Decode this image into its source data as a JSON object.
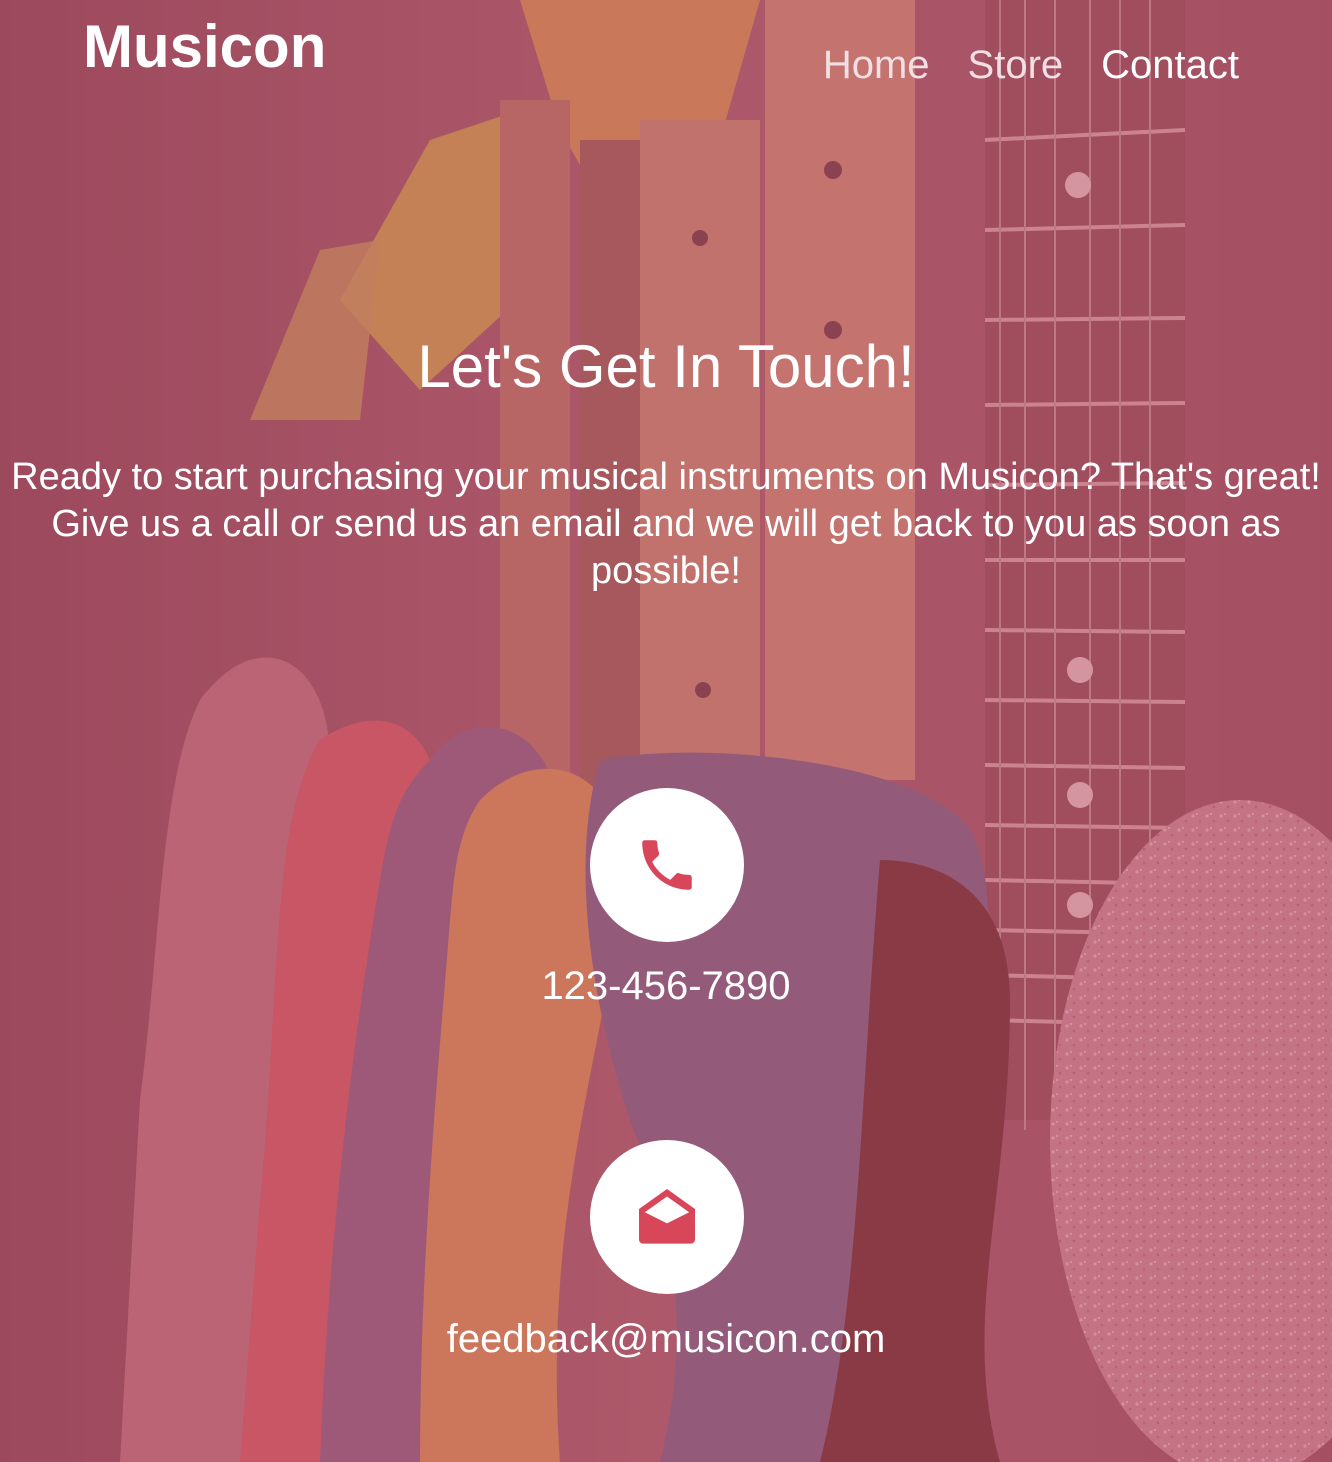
{
  "header": {
    "brand": "Musicon",
    "nav": [
      {
        "label": "Home"
      },
      {
        "label": "Store"
      },
      {
        "label": "Contact"
      }
    ]
  },
  "main": {
    "title": "Let's Get In Touch!",
    "lead": "Ready to start purchasing your musical instruments on Musicon? That's great! Give us a call or send us an email and we will get back to you as soon as possible!",
    "phone": {
      "icon": "phone-icon",
      "value": "123-456-7890"
    },
    "email": {
      "icon": "envelope-open-icon",
      "value": "feedback@musicon.com"
    }
  },
  "colors": {
    "accent": "#d8465a",
    "overlay": "#be5068",
    "text": "#ffffff"
  }
}
